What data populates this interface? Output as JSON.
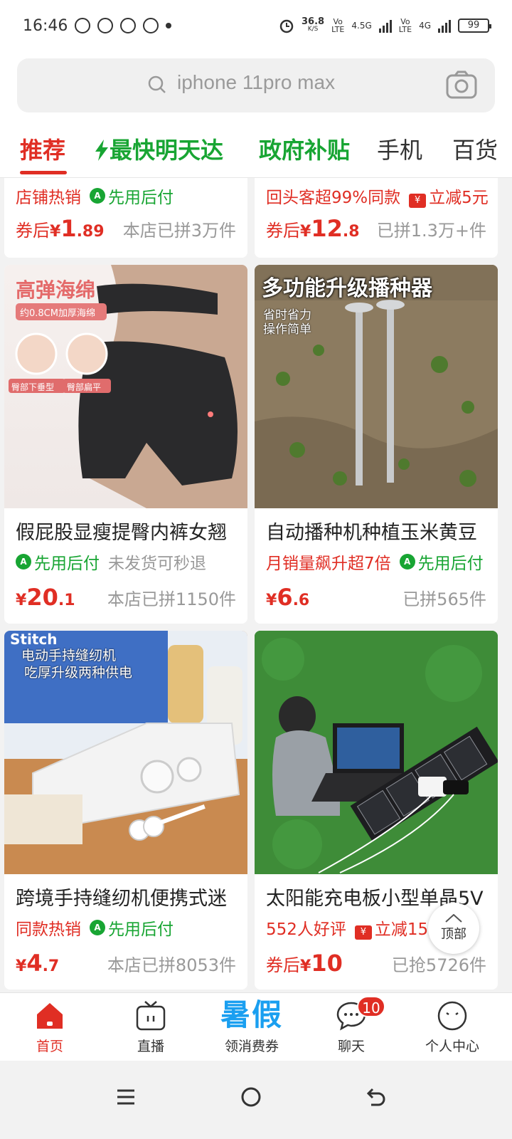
{
  "status_bar": {
    "time": "16:46",
    "net_speed_value": "36.8",
    "net_speed_unit": "K/S",
    "vo_lte_1": "Vo\nLTE",
    "network_1": "4.5G",
    "vo_lte_2": "Vo\nLTE",
    "network_2": "4G",
    "battery": "99"
  },
  "search": {
    "placeholder": "iphone 11pro max"
  },
  "tabs": [
    {
      "label": "推荐"
    },
    {
      "label": "最快明天达"
    },
    {
      "label": "政府补贴"
    },
    {
      "label": "手机"
    },
    {
      "label": "百货"
    }
  ],
  "feed": {
    "partial_left": {
      "tag1": "店铺热销",
      "tag2": "先用后付",
      "price_prefix": "券后",
      "currency": "¥",
      "price_int": "1",
      "price_dec": ".89",
      "sold": "本店已拼3万件"
    },
    "partial_right": {
      "tag1": "回头客超99%同款",
      "tag2": "立减5元",
      "price_prefix": "券后",
      "currency": "¥",
      "price_int": "12",
      "price_dec": ".8",
      "sold": "已拼1.3万+件"
    },
    "card1": {
      "image_text_1": "高弹海绵",
      "image_text_2": "约0.8CM加厚海绵",
      "image_text_3": "臀部下垂型",
      "image_text_4": "臀部扁平",
      "title": "假屁股显瘦提臀内裤女翘",
      "tag1": "先用后付",
      "tag2": "未发货可秒退",
      "currency": "¥",
      "price_int": "20",
      "price_dec": ".1",
      "sold": "本店已拼1150件"
    },
    "card2": {
      "image_text_1": "多功能升级播种器",
      "image_text_2": "省时省力",
      "image_text_3": "操作简单",
      "title": "自动播种机种植玉米黄豆",
      "tag1": "月销量飙升超7倍",
      "tag2": "先用后付",
      "currency": "¥",
      "price_int": "6",
      "price_dec": ".6",
      "sold": "已拼565件"
    },
    "card3": {
      "image_text_1": "电动手持缝纫机",
      "image_text_2": "吃厚升级两种供电",
      "title": "跨境手持缝纫机便携式迷",
      "tag1": "同款热销",
      "tag2": "先用后付",
      "currency": "¥",
      "price_int": "4",
      "price_dec": ".7",
      "sold": "本店已拼8053件"
    },
    "card4": {
      "title": "太阳能充电板小型单晶5V",
      "tag1": "552人好评",
      "tag2": "立减15元",
      "price_prefix": "券后",
      "currency": "¥",
      "price_int": "10",
      "price_dec": "",
      "sold": "已抢5726件"
    }
  },
  "back_to_top": "顶部",
  "bottom_nav": [
    {
      "label": "首页"
    },
    {
      "label": "直播"
    },
    {
      "label": "领消费券",
      "promo": "暑假"
    },
    {
      "label": "聊天",
      "badge": "10"
    },
    {
      "label": "个人中心"
    }
  ],
  "colors": {
    "brand_red": "#e02e24",
    "green": "#18a533",
    "promo_blue": "#1a9ff0"
  }
}
